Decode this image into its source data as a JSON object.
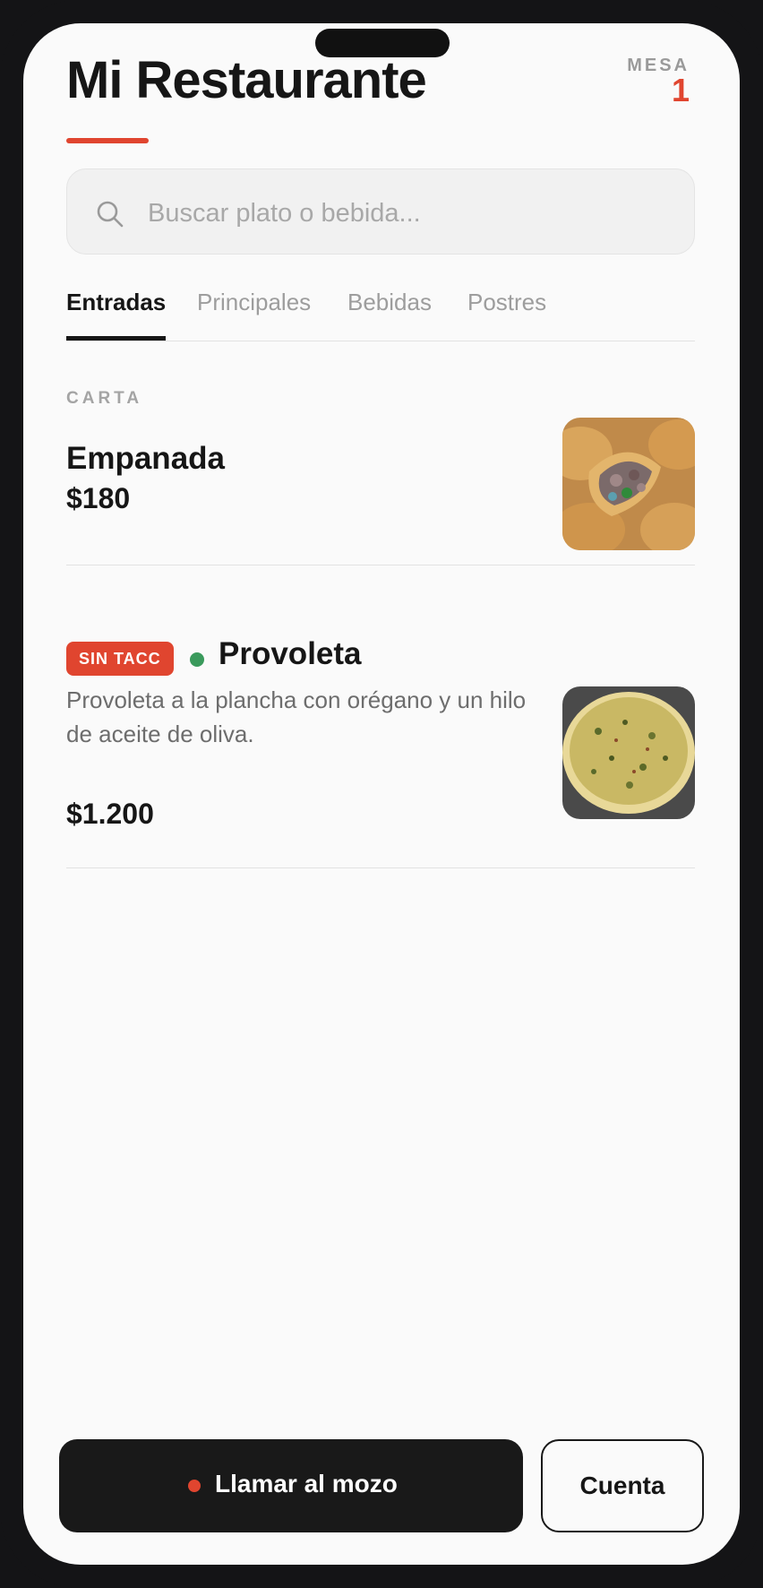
{
  "header": {
    "title": "Mi Restaurante",
    "table_label": "MESA",
    "table_number": "1"
  },
  "search": {
    "placeholder": "Buscar plato o bebida...",
    "value": ""
  },
  "tabs": [
    {
      "label": "Entradas",
      "active": true
    },
    {
      "label": "Principales",
      "active": false
    },
    {
      "label": "Bebidas",
      "active": false
    },
    {
      "label": "Postres",
      "active": false
    }
  ],
  "section_label": "CARTA",
  "items": [
    {
      "name": "Empanada",
      "price": "$180",
      "image": "empanada-photo"
    },
    {
      "badge": "SIN TACC",
      "name": "Provoleta",
      "description": "Provoleta a la plancha con orégano y un hilo de aceite de oliva.",
      "price": "$1.200",
      "image": "provoleta-photo"
    }
  ],
  "footer": {
    "call_waiter_label": "Llamar al mozo",
    "bill_label": "Cuenta"
  },
  "colors": {
    "accent": "#e0452f",
    "dark": "#191919",
    "veggie": "#3a9a5c",
    "background": "#fafafa"
  }
}
